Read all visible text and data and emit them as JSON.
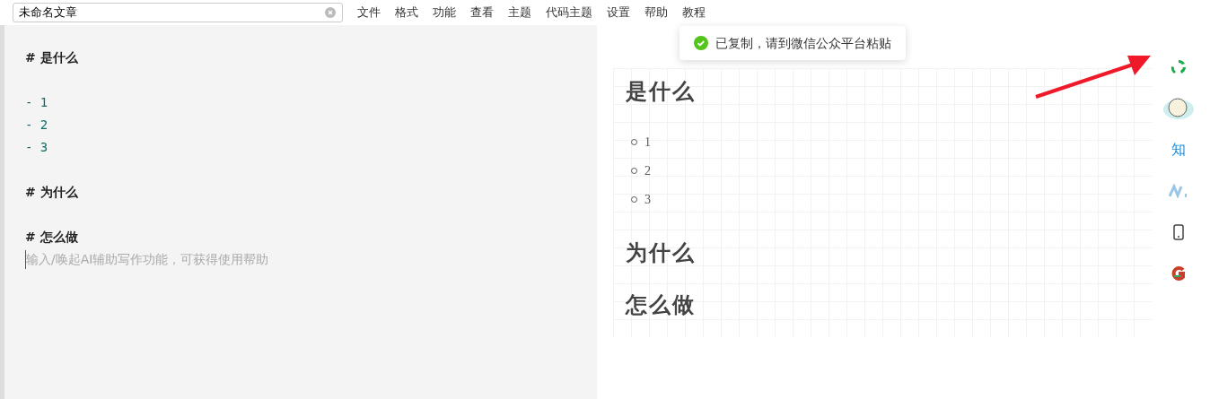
{
  "title_field": {
    "value": "未命名文章"
  },
  "menu": [
    "文件",
    "格式",
    "功能",
    "查看",
    "主题",
    "代码主题",
    "设置",
    "帮助",
    "教程"
  ],
  "toast": {
    "kind": "success",
    "text": "已复制，请到微信公众平台粘贴"
  },
  "editor": {
    "lines": [
      {
        "kind": "heading",
        "text": "# 是什么"
      },
      {
        "kind": "blank"
      },
      {
        "kind": "list",
        "text": "- 1"
      },
      {
        "kind": "list",
        "text": "- 2"
      },
      {
        "kind": "list",
        "text": "- 3"
      },
      {
        "kind": "blank"
      },
      {
        "kind": "heading",
        "text": "# 为什么"
      },
      {
        "kind": "blank"
      },
      {
        "kind": "heading",
        "text": "# 怎么做"
      }
    ],
    "placeholder": "输入/唤起AI辅助写作功能，可获得使用帮助"
  },
  "preview": [
    {
      "kind": "heading",
      "text": "是什么"
    },
    {
      "kind": "list",
      "items": [
        "1",
        "2",
        "3"
      ]
    },
    {
      "kind": "heading",
      "text": "为什么"
    },
    {
      "kind": "heading",
      "text": "怎么做"
    }
  ],
  "side_tools": [
    {
      "kind": "wechat"
    },
    {
      "kind": "avatar"
    },
    {
      "kind": "zhihu",
      "text": "知"
    },
    {
      "kind": "juejin"
    },
    {
      "kind": "phone"
    },
    {
      "kind": "csdn"
    }
  ]
}
